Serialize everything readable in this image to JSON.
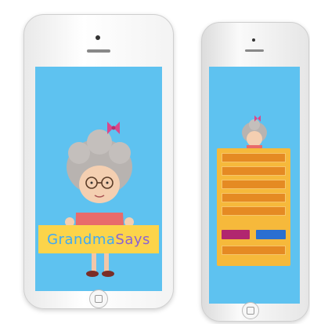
{
  "brand": {
    "part1": "Grandma",
    "part2": "Says"
  },
  "colors": {
    "sky": "#5ec2f0",
    "banner": "#fcd44a",
    "menu": "#f6b93b",
    "menu_item": "#e58a23"
  },
  "menu": {
    "items": [
      "",
      "",
      "",
      "",
      ""
    ],
    "buttons": [
      "",
      ""
    ],
    "footer": ""
  }
}
